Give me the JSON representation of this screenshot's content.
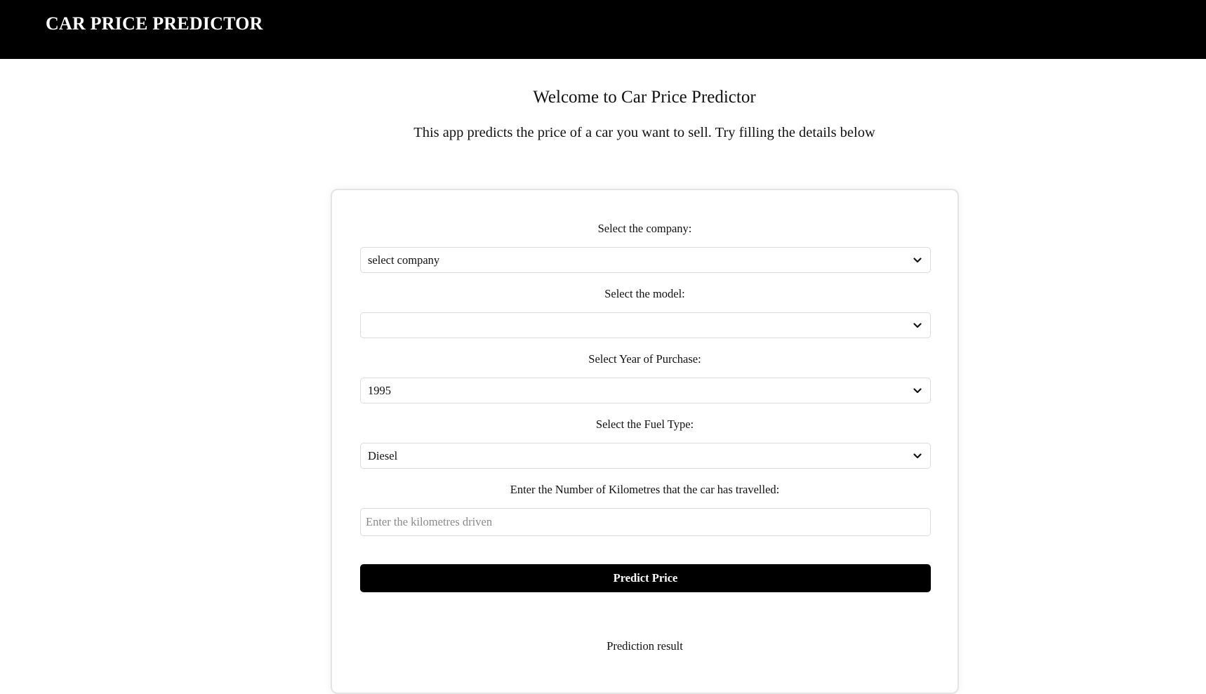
{
  "header": {
    "brand": "CAR PRICE PREDICTOR"
  },
  "intro": {
    "welcome": "Welcome to Car Price Predictor",
    "subtitle": "This app predicts the price of a car you want to sell. Try filling the details below"
  },
  "form": {
    "company": {
      "label": "Select the company:",
      "value": "select company"
    },
    "model": {
      "label": "Select the model:",
      "value": ""
    },
    "year": {
      "label": "Select Year of Purchase:",
      "value": "1995"
    },
    "fuel": {
      "label": "Select the Fuel Type:",
      "value": "Diesel"
    },
    "kms": {
      "label": "Enter the Number of Kilometres that the car has travelled:",
      "placeholder": "Enter the kilometres driven",
      "value": ""
    },
    "submit_label": "Predict Price",
    "result_label": "Prediction result"
  },
  "icons": {
    "dropdown": "chevron-down-icon"
  },
  "colors": {
    "header_bg": "#000000",
    "header_text": "#ffffff",
    "button_bg": "#000000",
    "button_text": "#ffffff",
    "card_border": "#e4e4e4"
  }
}
